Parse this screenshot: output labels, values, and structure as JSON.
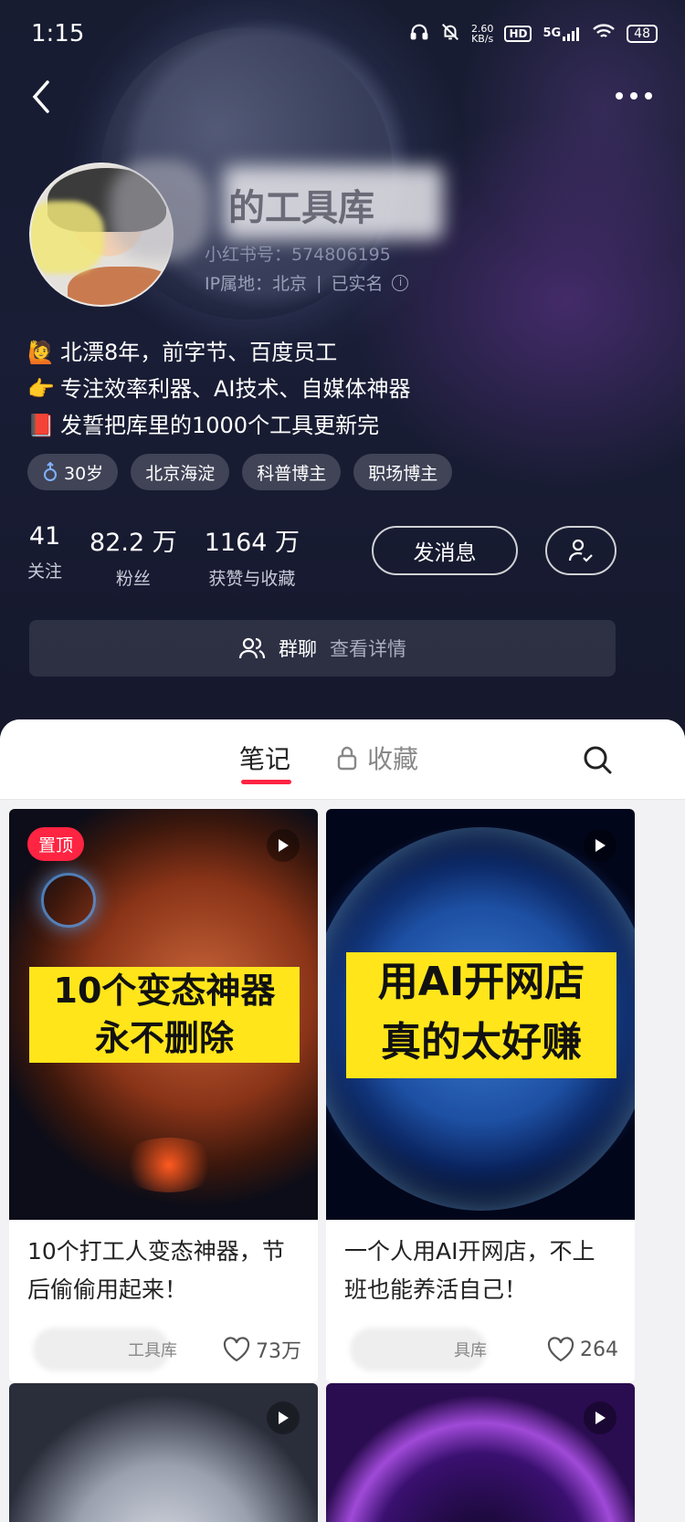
{
  "status_bar": {
    "time": "1:15",
    "net_speed": "2.60",
    "net_unit": "KB/s",
    "hd": "HD",
    "network": "5G",
    "battery": "48"
  },
  "profile": {
    "name": "的工具库",
    "redbook_id": "小红书号：574806195",
    "ip_location": "IP属地：北京",
    "verified": "已实名",
    "bio": [
      {
        "emoji": "🙋",
        "text": "北漂8年，前字节、百度员工"
      },
      {
        "emoji": "👉",
        "text": "专注效率利器、AI技术、自媒体神器"
      },
      {
        "emoji": "📕",
        "text": "发誓把库里的1000个工具更新完"
      }
    ],
    "tags": [
      {
        "icon": "male-icon",
        "label": "30岁"
      },
      {
        "label": "北京海淀"
      },
      {
        "label": "科普博主"
      },
      {
        "label": "职场博主"
      }
    ],
    "stats": [
      {
        "value": "41",
        "label": "关注"
      },
      {
        "value": "82.2 万",
        "label": "粉丝"
      },
      {
        "value": "1164 万",
        "label": "获赞与收藏"
      }
    ],
    "message_button": "发消息",
    "group_chat": {
      "label": "群聊",
      "action": "查看详情"
    }
  },
  "tabs": {
    "notes": "笔记",
    "collections": "收藏"
  },
  "notes": [
    {
      "pinned": "置顶",
      "banner_line1": "10个变态神器",
      "banner_line2": "永不删除",
      "title": "10个打工人变态神器，节后偷偷用起来！",
      "author": "工具库",
      "likes": "73万"
    },
    {
      "banner_line1": "用AI开网店",
      "banner_line2": "真的太好赚",
      "title": "一个人用AI开网店，不上班也能养活自己！",
      "author": "具库",
      "likes": "264"
    }
  ]
}
